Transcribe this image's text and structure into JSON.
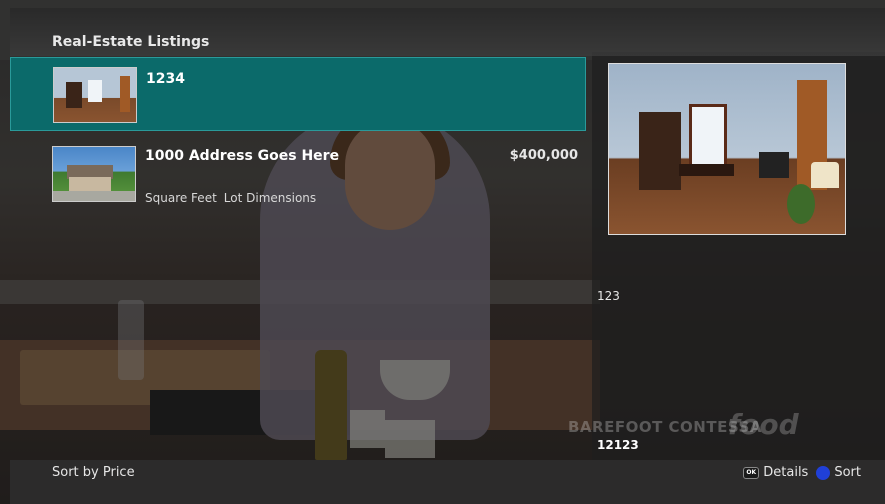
{
  "header": {
    "title": "Real-Estate Listings"
  },
  "listings": [
    {
      "title": "1234",
      "price": "",
      "square_feet": "",
      "lot_dimensions": ""
    },
    {
      "title": "1000 Address Goes Here",
      "price": "$400,000",
      "square_feet": "Square Feet",
      "lot_dimensions": "Lot Dimensions"
    }
  ],
  "details": {
    "line1": "123",
    "line2": "12123"
  },
  "background": {
    "watermark": "BAREFOOT CONTESSA",
    "network": "food"
  },
  "footer": {
    "sort_label": "Sort by Price",
    "details_label": "Details",
    "sort_action_label": "Sort",
    "ok_key": "OK"
  },
  "colors": {
    "selected": "#0b6a6a",
    "blue_button": "#2040d8"
  }
}
